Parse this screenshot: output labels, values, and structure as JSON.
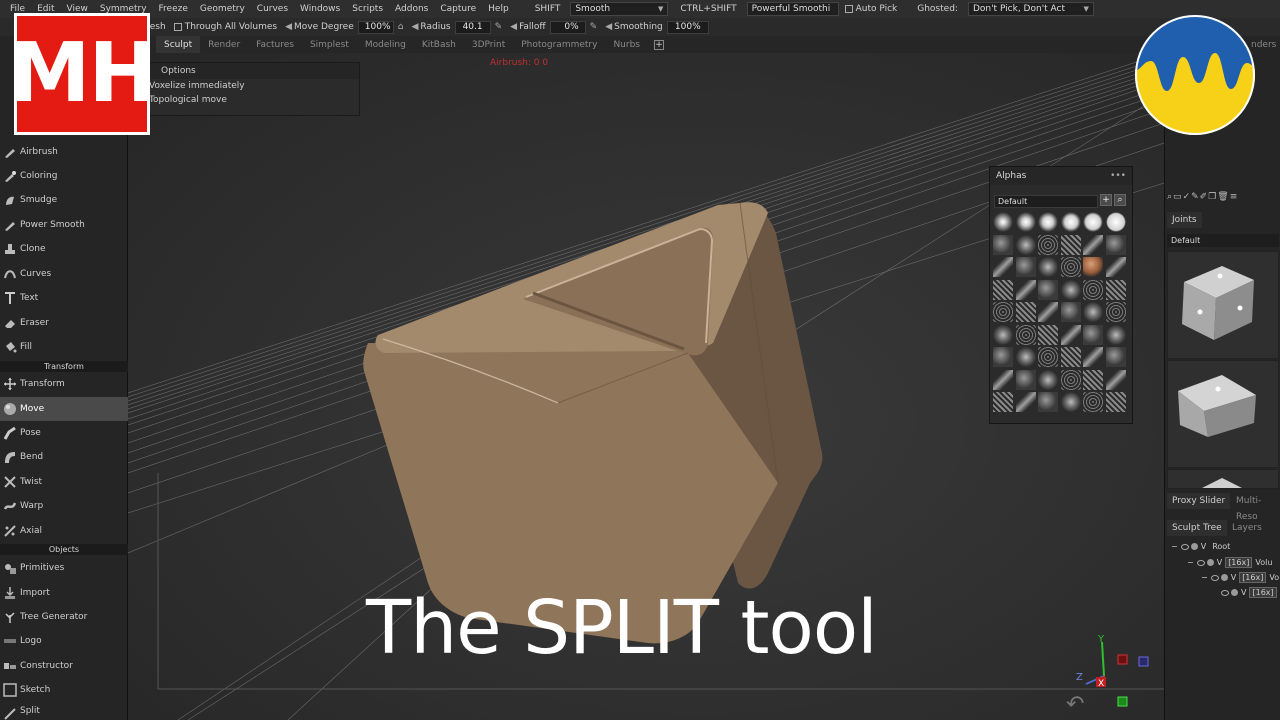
{
  "menu": {
    "items": [
      "File",
      "Edit",
      "View",
      "Symmetry",
      "Freeze",
      "Geometry",
      "Curves",
      "Windows",
      "Scripts",
      "Addons",
      "Capture",
      "Help"
    ],
    "shift_label": "SHIFT",
    "shift_value": "Smooth",
    "ctrl_shift_label": "CTRL+SHIFT",
    "ctrl_shift_value": "Powerful Smoothi",
    "auto_pick": "Auto Pick",
    "ghosted_label": "Ghosted:",
    "ghosted_value": "Don't Pick, Don't Act"
  },
  "toolbar": {
    "mesh_label": "Mesh",
    "through_all_volumes": "Through All Volumes",
    "move_degree_label": "Move Degree",
    "move_degree_value": "100%",
    "radius_label": "Radius",
    "radius_value": "40.1",
    "falloff_label": "Falloff",
    "falloff_value": "0%",
    "smoothing_label": "Smoothing",
    "smoothing_value": "100%"
  },
  "tabs": [
    "Sculpt",
    "Render",
    "Factures",
    "Simplest",
    "Modeling",
    "KitBash",
    "3DPrint",
    "Photogrammetry",
    "Nurbs"
  ],
  "active_tab": "Sculpt",
  "tools": {
    "group1": [
      "Airbrush",
      "Coloring",
      "Smudge",
      "Power Smooth",
      "Clone",
      "Curves",
      "Text",
      "Eraser",
      "Fill"
    ],
    "transform_header": "Transform",
    "group2": [
      "Transform",
      "Move",
      "Pose",
      "Bend",
      "Twist",
      "Warp",
      "Axial"
    ],
    "objects_header": "Objects",
    "group3": [
      "Primitives",
      "Import",
      "Tree Generator",
      "Logo",
      "Constructor",
      "Sketch",
      "Split"
    ],
    "active": "Move"
  },
  "tool_options": {
    "title": "Options",
    "row1": "Voxelize immediately",
    "row2": "Topological move"
  },
  "warning_text": "Airbrush: 0 0",
  "alphas": {
    "title": "Alphas",
    "preset": "Default"
  },
  "right_panel": {
    "joints_tab": "Joints",
    "joints_preset": "Default",
    "proxy_slider_tab": "Proxy Slider",
    "multi_res_tab": "Multi-Reso",
    "sculpt_tree_tab": "Sculpt Tree",
    "layers_tab": "Layers",
    "tree": {
      "root": "Root",
      "badge": "[16x]",
      "row1": "Volu",
      "row2": "Vo"
    },
    "top_tab_partial": "nders"
  },
  "overlay": {
    "logo_text": "MH",
    "caption": "The SPLIT tool"
  },
  "gizmo": {
    "y": "Y",
    "z": "Z",
    "x": "X"
  },
  "colors": {
    "logo_red": "#e41b13",
    "ua_blue": "#1f5fae",
    "ua_yellow": "#f7d117",
    "mesh": "#9b7e60"
  }
}
